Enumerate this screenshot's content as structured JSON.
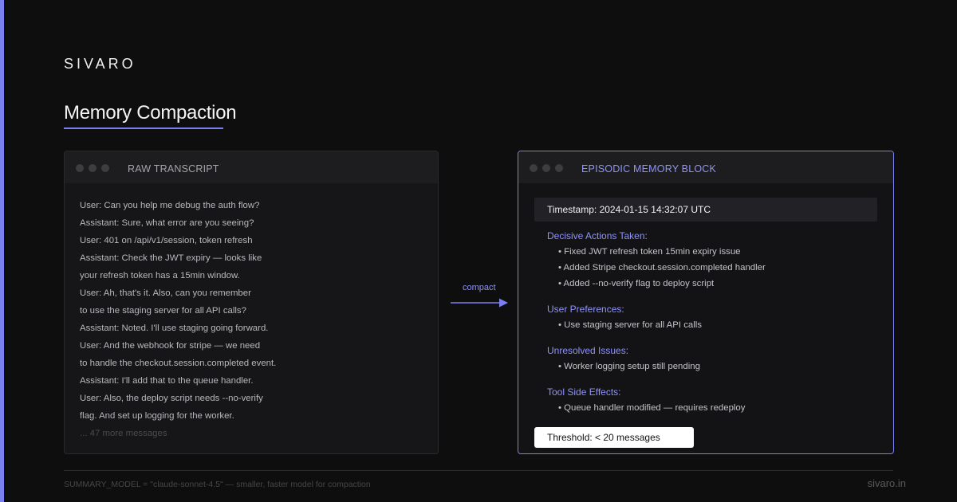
{
  "brand": "SIVARO",
  "title": "Memory Compaction",
  "colors": {
    "accent": "#7b7ff0",
    "background": "#0e0e0e"
  },
  "left_panel": {
    "label": "RAW TRANSCRIPT",
    "lines": [
      "User: Can you help me debug the auth flow?",
      "Assistant: Sure, what error are you seeing?",
      "User: 401 on /api/v1/session, token refresh",
      "Assistant: Check the JWT expiry — looks like",
      "your refresh token has a 15min window.",
      "User: Ah, that's it. Also, can you remember",
      "to use the staging server for all API calls?",
      "Assistant: Noted. I'll use staging going forward.",
      "User: And the webhook for stripe — we need",
      "to handle the checkout.session.completed event.",
      "Assistant: I'll add that to the queue handler.",
      "User: Also, the deploy script needs --no-verify",
      "flag. And set up logging for the worker."
    ],
    "more": "... 47 more messages"
  },
  "arrow": {
    "label": "compact"
  },
  "right_panel": {
    "label": "EPISODIC MEMORY BLOCK",
    "timestamp": "Timestamp: 2024-01-15 14:32:07 UTC",
    "sections": [
      {
        "heading": "Decisive Actions Taken:",
        "items": [
          "• Fixed JWT refresh token 15min expiry issue",
          "• Added Stripe checkout.session.completed handler",
          "• Added --no-verify flag to deploy script"
        ]
      },
      {
        "heading": "User Preferences:",
        "items": [
          "• Use staging server for all API calls"
        ]
      },
      {
        "heading": "Unresolved Issues:",
        "items": [
          "• Worker logging setup still pending"
        ]
      },
      {
        "heading": "Tool Side Effects:",
        "items": [
          "• Queue handler modified — requires redeploy"
        ]
      }
    ],
    "threshold": "Threshold: < 20 messages"
  },
  "footer": {
    "note": "SUMMARY_MODEL = \"claude-sonnet-4.5\" — smaller, faster model for compaction",
    "site": "sivaro.in"
  }
}
